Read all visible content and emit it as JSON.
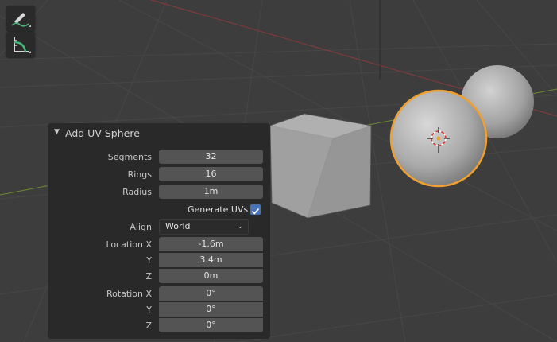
{
  "toolbar": {
    "tools": [
      {
        "icon": "annotate-icon"
      },
      {
        "icon": "measure-icon"
      }
    ]
  },
  "operator_panel": {
    "title": "Add UV Sphere",
    "segments": {
      "label": "Segments",
      "value": "32"
    },
    "rings": {
      "label": "Rings",
      "value": "16"
    },
    "radius": {
      "label": "Radius",
      "value": "1m"
    },
    "generate_uvs": {
      "label": "Generate UVs",
      "checked": true
    },
    "align": {
      "label": "Align",
      "value": "World"
    },
    "location": {
      "label_x": "Location X",
      "label_y": "Y",
      "label_z": "Z",
      "x": "-1.6m",
      "y": "3.4m",
      "z": "0m"
    },
    "rotation": {
      "label_x": "Rotation X",
      "label_y": "Y",
      "label_z": "Z",
      "x": "0°",
      "y": "0°",
      "z": "0°"
    }
  },
  "colors": {
    "background": "#3d3d3d",
    "panel": "#282828",
    "field": "#545454",
    "accent": "#4772b3",
    "selection": "#f0a030",
    "x_axis": "#8a3a3a",
    "y_axis": "#6a8a30"
  }
}
